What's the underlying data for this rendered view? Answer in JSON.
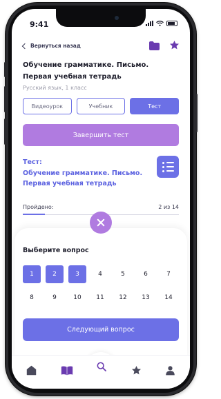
{
  "status_bar": {
    "time": "9:41"
  },
  "nav": {
    "back_label": "Вернуться назад"
  },
  "book": {
    "title_line1": "Обучение грамматике. Письмо.",
    "title_line2": "Первая учебная тетрадь",
    "subtitle": "Русский язык, 1 класс"
  },
  "tabs": [
    {
      "label": "Видеоурок",
      "active": false
    },
    {
      "label": "Учебник",
      "active": false
    },
    {
      "label": "Тест",
      "active": true
    }
  ],
  "finish_button": {
    "label": "Завершить тест"
  },
  "test": {
    "line1": "Тест:",
    "line2": "Обучение грамматике. Письмо.",
    "line3": "Первая учебная тетрадь"
  },
  "progress": {
    "label": "Пройдено:",
    "count_text": "2 из 14",
    "done": 2,
    "total": 14
  },
  "question_picker": {
    "label": "Выберите вопрос",
    "numbers": [
      "1",
      "2",
      "3",
      "4",
      "5",
      "6",
      "7",
      "8",
      "9",
      "10",
      "11",
      "12",
      "13",
      "14"
    ],
    "highlighted": [
      "1",
      "2",
      "3"
    ]
  },
  "next_button": {
    "label": "Следующий вопрос"
  },
  "tabbar": {
    "items": [
      "home-icon",
      "book-icon",
      "search-icon",
      "star-icon",
      "profile-icon"
    ]
  },
  "colors": {
    "accent": "#6c70e6",
    "purple": "#b07be0",
    "text": "#1d1d2b",
    "muted": "#9a9aa8"
  }
}
